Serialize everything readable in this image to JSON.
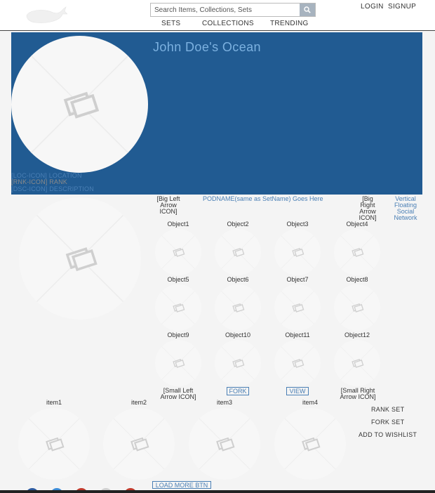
{
  "header": {
    "search_placeholder": "Search Items, Collections, Sets",
    "nav": {
      "sets": "SETS",
      "collections": "COLLECTIONS",
      "trending": "TRENDING"
    },
    "login": "LOGIN",
    "signup": "SIGNUP"
  },
  "profile": {
    "title": "John Doe's Ocean",
    "location": "[LOC-ICON] LOCATION",
    "rank": "[RNK-ICON] RANK",
    "description": "[DSC-ICON] DESCRIPTION"
  },
  "set": {
    "big_left_arrow": "[Big Left Arrow ICON]",
    "podname": "PODNAME(same as SetName) Goes Here",
    "big_right_arrow": "[Big Right Arrow ICON]",
    "social": "Vertical Floating Social Network",
    "objects": [
      "Object1",
      "Object2",
      "Object3",
      "Object4",
      "Object5",
      "Object6",
      "Object7",
      "Object8",
      "Object9",
      "Object10",
      "Object11",
      "Object12"
    ],
    "small_left_arrow": "[Small Left Arrow ICON]",
    "fork": "FORK",
    "view": "VIEW",
    "small_right_arrow": "[Small Right Arrow ICON]"
  },
  "items": [
    "item1",
    "item2",
    "item3",
    "item4"
  ],
  "actions": {
    "rank_set": "RANK SET",
    "fork_set": "FORK SET",
    "add_to_wishlist": "ADD TO WISHLIST"
  },
  "load_more": "LOAD MORE BTN",
  "colors": {
    "banner": "#215b92",
    "title": "#7cb1e0",
    "link": "#4a7fb5",
    "rank": "#8a8a8a"
  },
  "icons": {
    "logo": "whale-logo-icon",
    "search": "search-icon",
    "placeholder": "image-placeholder-icon"
  }
}
